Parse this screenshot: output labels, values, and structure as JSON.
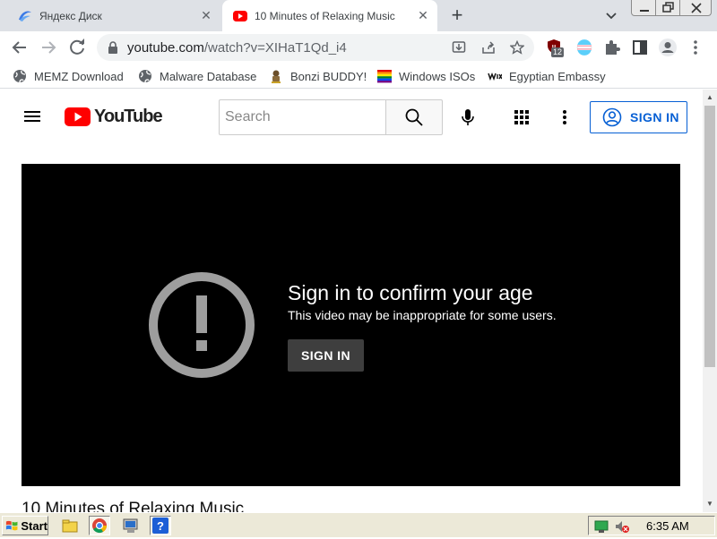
{
  "browser": {
    "tabs": [
      {
        "title": "Яндекс Диск",
        "active": false
      },
      {
        "title": "10 Minutes of Relaxing Music",
        "active": true
      }
    ],
    "address": {
      "host": "youtube.com",
      "path": "/watch?v=XIHaT1Qd_i4"
    },
    "extension_badge": "12",
    "bookmarks": [
      {
        "label": "MEMZ Download",
        "icon": "globe-icon"
      },
      {
        "label": "Malware Database",
        "icon": "globe-icon"
      },
      {
        "label": "Bonzi BUDDY!",
        "icon": "bonzi-icon"
      },
      {
        "label": "Windows ISOs",
        "icon": "rainbow-flag-icon"
      },
      {
        "label": "Egyptian Embassy",
        "icon": "wix-icon"
      }
    ]
  },
  "youtube": {
    "logo_text": "YouTube",
    "search_placeholder": "Search",
    "signin_label": "SIGN IN",
    "player": {
      "heading": "Sign in to confirm your age",
      "subtext": "This video may be inappropriate for some users.",
      "button": "SIGN IN"
    },
    "video_title": "10 Minutes of Relaxing Music"
  },
  "taskbar": {
    "start_label": "Start",
    "clock": "6:35 AM"
  },
  "colors": {
    "youtube_red": "#ff0000",
    "link_blue": "#065fd4",
    "player_bg": "#000000",
    "taskbar": "#ece9d8"
  }
}
